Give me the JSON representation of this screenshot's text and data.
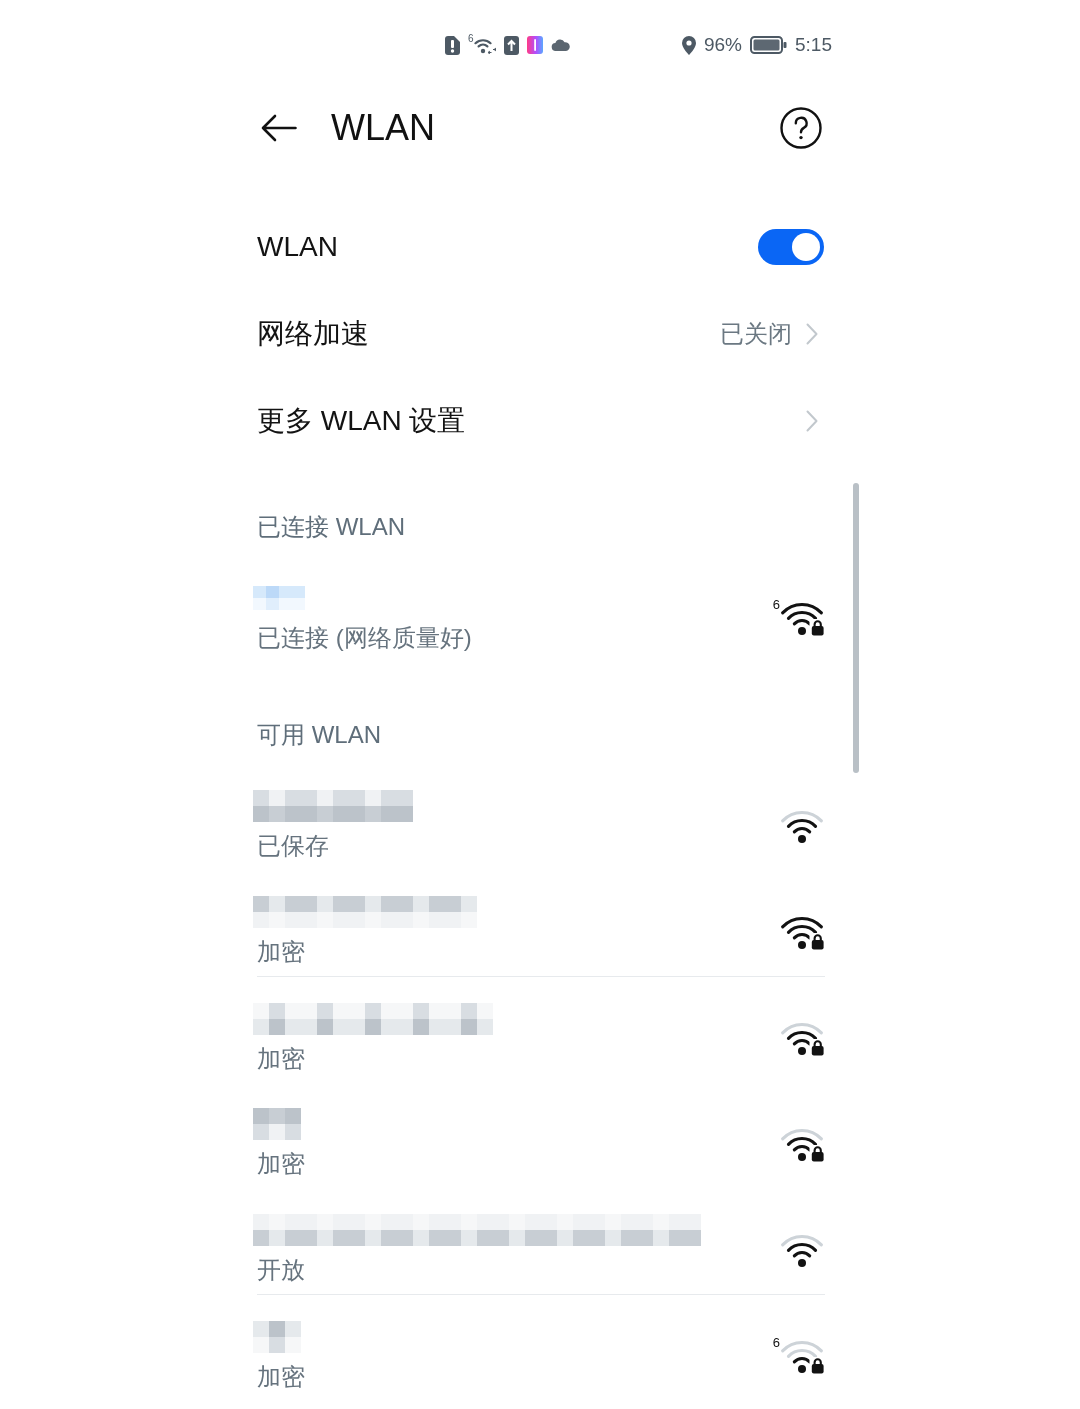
{
  "status_bar": {
    "wifi_badge": "6",
    "battery": "96%",
    "time": "5:15"
  },
  "header": {
    "title": "WLAN"
  },
  "settings": [
    {
      "kind": "switch",
      "label": "WLAN",
      "on": true
    },
    {
      "kind": "link",
      "label": "网络加速",
      "value": "已关闭"
    },
    {
      "kind": "link",
      "label": "更多 WLAN 设置"
    }
  ],
  "sections": [
    {
      "title": "已连接 WLAN",
      "networks": [
        {
          "kind": "strong",
          "status": "已连接 (网络质量好)",
          "connected": true,
          "secured": true,
          "badge": "6",
          "divider_above": false
        }
      ]
    },
    {
      "title": "可用 WLAN",
      "networks": [
        {
          "kind": "medium",
          "status": "已保存",
          "connected": false,
          "secured": false,
          "divider_above": false
        },
        {
          "kind": "strong",
          "status": "加密",
          "connected": false,
          "secured": true,
          "divider_above": false
        },
        {
          "kind": "medium",
          "status": "加密",
          "connected": false,
          "secured": true,
          "divider_above": true
        },
        {
          "kind": "medium",
          "status": "加密",
          "connected": false,
          "secured": true,
          "divider_above": false
        },
        {
          "kind": "medium",
          "status": "开放",
          "connected": false,
          "secured": false,
          "divider_above": false
        },
        {
          "kind": "weak",
          "status": "加密",
          "connected": false,
          "secured": true,
          "badge": "6",
          "divider_above": true
        }
      ]
    }
  ]
}
